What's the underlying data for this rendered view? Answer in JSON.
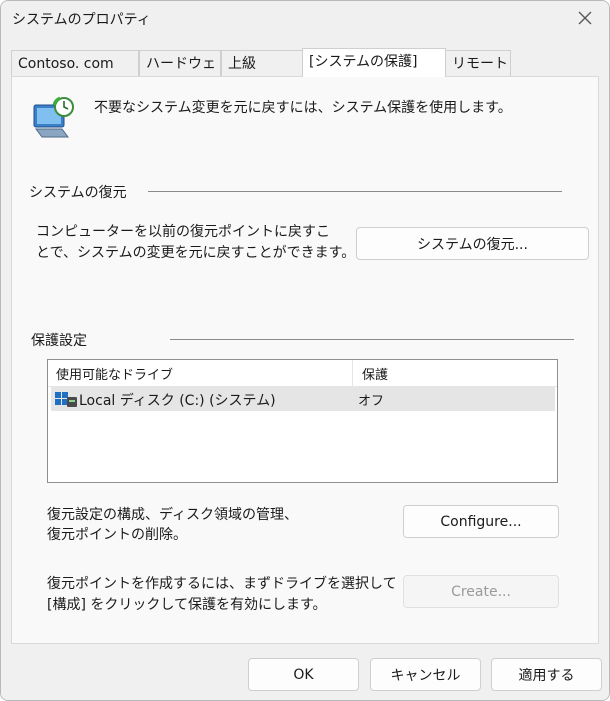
{
  "window": {
    "title": "システムのプロパティ"
  },
  "tabs": [
    {
      "label": "Contoso. com"
    },
    {
      "label": "ハードウェア"
    },
    {
      "label": "上級"
    },
    {
      "label": "[システムの保護]"
    },
    {
      "label": "リモート"
    }
  ],
  "header": {
    "description": "不要なシステム変更を元に戻すには、システム保護を使用します。"
  },
  "restore": {
    "section_label": "システムの復元",
    "description_line1": "コンピューターを以前の復元ポイントに戻すこ",
    "description_line2": "とで、システムの変更を元に戻すことができます。",
    "button_label": "システムの復元..."
  },
  "protection": {
    "section_label": "保護設定",
    "columns": [
      "使用可能なドライブ",
      "保護"
    ],
    "drives": [
      {
        "name": "Local ディスク (C:) (システム)",
        "status": "オフ"
      }
    ],
    "configure_text_line1": "復元設定の構成、ディスク領域の管理、",
    "configure_text_line2": "復元ポイントの削除。",
    "configure_button": "Configure...",
    "create_text_line1": "復元ポイントを作成するには、まずドライブを選択して",
    "create_text_line2": "[構成] をクリックして保護を有効にします。",
    "create_button": "Create..."
  },
  "footer": {
    "ok": "OK",
    "cancel": "キャンセル",
    "apply": "適用する"
  }
}
